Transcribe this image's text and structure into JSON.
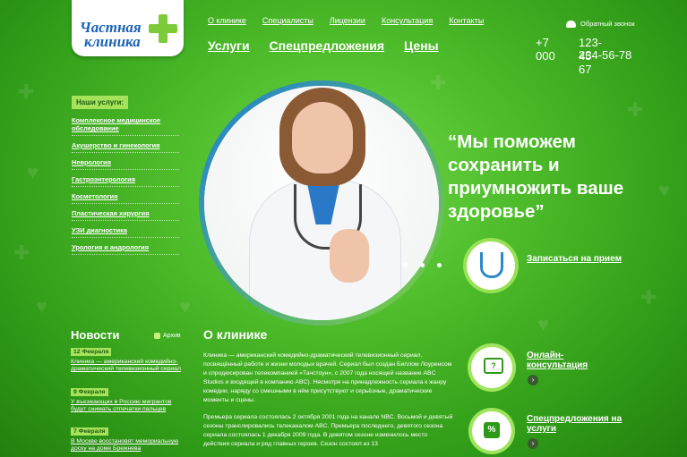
{
  "logo": {
    "line1": "Частная",
    "line2": "клиника"
  },
  "top_nav": [
    "О клинике",
    "Специалисты",
    "Лицензии",
    "Консультация",
    "Контакты"
  ],
  "main_nav": [
    "Услуги",
    "Спецпредложения",
    "Цены"
  ],
  "callback_label": "Обратный звонок",
  "phone": {
    "code": "+7 000",
    "number1": "123-45-67",
    "number2": "234-56-78"
  },
  "services": {
    "title": "Наши услуги:",
    "items": [
      "Комплексное медицинское обследование",
      "Акушерство и гинекология",
      "Неврология",
      "Гастроэнтерология",
      "Косметология",
      "Пластическая хирургия",
      "УЗИ диагностика",
      "Урология и андрология"
    ]
  },
  "hero": {
    "quote": "“Мы поможем сохранить и приумножить ваше здоровье”",
    "appointment_label": "Записаться на прием"
  },
  "news": {
    "title": "Новости",
    "archive_label": "Архив",
    "items": [
      {
        "date": "12 Февраля",
        "text": "Клиника — американский комедийно-драматический телевизионный сериал"
      },
      {
        "date": "9 Февраля",
        "text": "У въезжающих в Россию мигрантов будут снимать отпечатки пальцев"
      },
      {
        "date": "7 Февраля",
        "text": "В Москве восстановят мемориальную доску на доме Брежнева"
      }
    ]
  },
  "about": {
    "title": "О клинике",
    "p1": "Клиника — американский комедийно-драматический телевизионный сериал, посвящённый работе и жизни молодых врачей. Сериал был создан Биллом Лоуренсом и спродюсирован телекомпанией «Тачстоун», с 2007 года носящей название ABC Studios и входящей в компанию ABC). Несмотря на принадлежность сериала к жанру комедии, наряду со смешными в нём присутствуют и серьёзные, драматические моменты и сцены.",
    "p2": "Премьера сериала состоялась 2 октября 2001 года на канале NBC. Восьмой и девятый сезоны транслировались телеканалом ABC. Премьера последнего, девятого сезона сериала состоялась 1 декабря 2009 года. В девятом сезоне изменилось место действия сериала и ряд главных героев. Сезон состоял из 13"
  },
  "side_links": {
    "consult": "Онлайн-консультация",
    "offers": "Спецпредложения на услуги"
  },
  "colors": {
    "accent": "#a6e25a",
    "brand_blue": "#1b62b8",
    "bg_green": "#4fbd2b"
  }
}
